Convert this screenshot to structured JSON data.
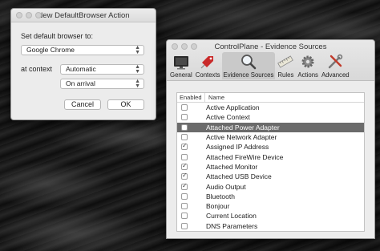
{
  "dialog": {
    "title": "New DefaultBrowser Action",
    "label_browser": "Set default browser to:",
    "browser_value": "Google Chrome",
    "label_context": "at context",
    "context_value": "Automatic",
    "timing_value": "On arrival",
    "cancel_label": "Cancel",
    "ok_label": "OK"
  },
  "window": {
    "title": "ControlPlane - Evidence Sources",
    "tabs": [
      {
        "label": "General",
        "icon": "monitor-icon"
      },
      {
        "label": "Contexts",
        "icon": "tag-icon"
      },
      {
        "label": "Evidence Sources",
        "icon": "magnifier-icon"
      },
      {
        "label": "Rules",
        "icon": "ruler-icon"
      },
      {
        "label": "Actions",
        "icon": "gear-icon"
      },
      {
        "label": "Advanced",
        "icon": "tools-icon"
      }
    ],
    "active_tab": "Evidence Sources",
    "columns": {
      "enabled": "Enabled",
      "name": "Name"
    },
    "rows": [
      {
        "name": "Active Application",
        "enabled": false
      },
      {
        "name": "Active Context",
        "enabled": false
      },
      {
        "name": "Attached Power Adapter",
        "enabled": false,
        "selected": true
      },
      {
        "name": "Active Network Adapter",
        "enabled": false
      },
      {
        "name": "Assigned IP Address",
        "enabled": true
      },
      {
        "name": "Attached FireWire Device",
        "enabled": false
      },
      {
        "name": "Attached Monitor",
        "enabled": true
      },
      {
        "name": "Attached USB Device",
        "enabled": true
      },
      {
        "name": "Audio Output",
        "enabled": true
      },
      {
        "name": "Bluetooth",
        "enabled": false
      },
      {
        "name": "Bonjour",
        "enabled": false
      },
      {
        "name": "Current Location",
        "enabled": false
      },
      {
        "name": "DNS Parameters",
        "enabled": false
      }
    ]
  }
}
